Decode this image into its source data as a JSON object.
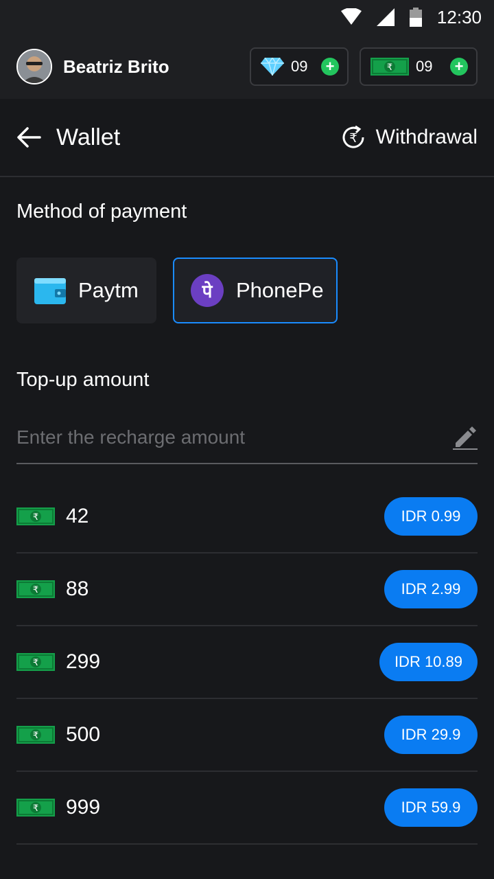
{
  "status_bar": {
    "time": "12:30"
  },
  "user": {
    "name": "Beatriz Brito"
  },
  "balances": {
    "gems": "09",
    "cash": "09"
  },
  "header": {
    "title": "Wallet",
    "withdrawal_label": "Withdrawal"
  },
  "payment": {
    "section_label": "Method of payment",
    "methods": [
      {
        "label": "Paytm",
        "selected": false
      },
      {
        "label": "PhonePe",
        "selected": true
      }
    ]
  },
  "topup": {
    "section_label": "Top-up amount",
    "placeholder": "Enter the recharge amount",
    "packages": [
      {
        "amount": "42",
        "price": "IDR 0.99"
      },
      {
        "amount": "88",
        "price": "IDR 2.99"
      },
      {
        "amount": "299",
        "price": "IDR 10.89"
      },
      {
        "amount": "500",
        "price": "IDR 29.9"
      },
      {
        "amount": "999",
        "price": "IDR 59.9"
      }
    ]
  },
  "colors": {
    "accent": "#0a7cf2",
    "selected_border": "#1a8cff",
    "plus_green": "#23c55e",
    "cash_green": "#14a04a",
    "phonepe_purple": "#6b3fc2",
    "background": "#17181b"
  }
}
